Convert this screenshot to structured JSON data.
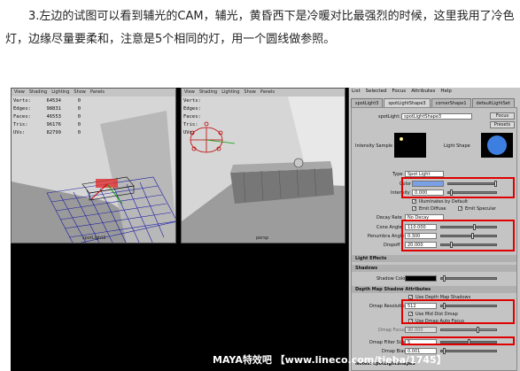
{
  "caption": "3.左边的试图可以看到辅光的CAM，辅光，黄昏西下是冷暖对比最强烈的时候，这里我用了冷色灯，边缘尽量要柔和，注意是5个相同的灯，用一个圆线做参照。",
  "viewport_menu": [
    "View",
    "Shading",
    "Lighting",
    "Show",
    "Panels"
  ],
  "viewport_left": {
    "stats": [
      {
        "k": "Verts:",
        "v": "64534",
        "z": "0"
      },
      {
        "k": "Edges:",
        "v": "98831",
        "z": "0"
      },
      {
        "k": "Faces:",
        "v": "46553",
        "z": "0"
      },
      {
        "k": "Tris:",
        "v": "96176",
        "z": "0"
      },
      {
        "k": "UVs:",
        "v": "82799",
        "z": "0"
      }
    ],
    "label": "spotLight3"
  },
  "viewport_right": {
    "stats": [
      {
        "k": "Verts:",
        "v": "",
        "z": ""
      },
      {
        "k": "Edges:",
        "v": "",
        "z": ""
      },
      {
        "k": "Faces:",
        "v": "",
        "z": ""
      },
      {
        "k": "Tris:",
        "v": "",
        "z": ""
      },
      {
        "k": "UVs:",
        "v": "",
        "z": ""
      }
    ],
    "label": "persp"
  },
  "attribute_editor": {
    "menu": [
      "List",
      "Selected",
      "Focus",
      "Attributes",
      "Help"
    ],
    "tabs": [
      "spotLight3",
      "spotLightShape3",
      "cornerShape1",
      "defaultLightSet"
    ],
    "node_label": "spotLight:",
    "node_value": "spotLightShape3",
    "focus_button": "Focus",
    "presets_button": "Presets",
    "intensity_sample_label": "Intensity Sample",
    "light_shape_label": "Light Shape",
    "type_label": "Type",
    "type_value": "Spot Light",
    "color_label": "Color",
    "intensity_label": "Intensity",
    "intensity_value": "0.000",
    "illuminates_label": "Illuminates by Default",
    "emit_diffuse_label": "Emit Diffuse",
    "emit_specular_label": "Emit Specular",
    "decay_rate_label": "Decay Rate",
    "decay_rate_value": "No Decay",
    "cone_angle_label": "Cone Angle",
    "cone_angle_value": "110.000",
    "penumbra_label": "Penumbra Angle",
    "penumbra_value": "0.300",
    "dropoff_label": "Dropoff",
    "dropoff_value": "20.000",
    "light_effects_label": "Light Effects",
    "shadows_label": "Shadows",
    "shadow_color_label": "Shadow Color",
    "depth_map_label": "Depth Map Shadow Attributes",
    "use_dmap_label": "Use Depth Map Shadows",
    "resolution_label": "Dmap Resolution",
    "resolution_value": "512",
    "mid_dist_label": "Use Mid Dist Dmap",
    "auto_focus_label": "Use Dmap Auto Focus",
    "focus_label": "Dmap Focus",
    "focus_value": "90.000",
    "filter_size_label": "Dmap Filter Size",
    "filter_size_value": "5",
    "bias_label": "Dmap Bias",
    "bias_value": "0.001",
    "notes_label": "Notes: spotLightShape3",
    "colors": {
      "light_color": "#7aa0e8",
      "shape_circle": "#3d7fe0"
    }
  },
  "watermark": "MAYA特效吧 【www.lineco.com/tieba/1745】"
}
